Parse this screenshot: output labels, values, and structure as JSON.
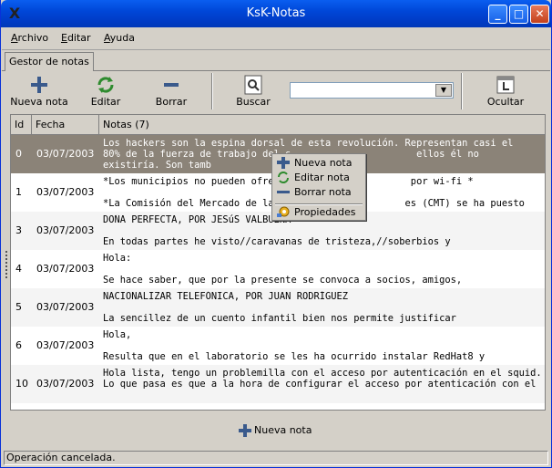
{
  "window": {
    "title": "KsK-Notas"
  },
  "menu": {
    "archivo": "Archivo",
    "editar": "Editar",
    "ayuda": "Ayuda"
  },
  "tab": {
    "label": "Gestor de notas"
  },
  "toolbar": {
    "new_note": "Nueva nota",
    "edit": "Editar",
    "delete": "Borrar",
    "search": "Buscar",
    "hide": "Ocultar",
    "search_value": ""
  },
  "table": {
    "columns": {
      "id": "Id",
      "date": "Fecha",
      "notes": "Notas (7)"
    },
    "rows": [
      {
        "id": "0",
        "date": "03/07/2003",
        "note": "Los hackers son la espina dorsal de esta revolución. Representan casi el\n80% de la fuerza de trabajo del s                      ellos él no\nexistiría. Son tamb"
      },
      {
        "id": "1",
        "date": "03/07/2003",
        "note": "*Los municipios no pueden ofrec                       por wi-fi *\n\n*La Comisión del Mercado de las                      es (CMT) se ha puesto"
      },
      {
        "id": "3",
        "date": "03/07/2003",
        "note": "DOÑA PERFECTA, POR JESúS VALBUENA\n\nEn todas partes he visto//caravanas de tristeza,//soberbios y"
      },
      {
        "id": "4",
        "date": "03/07/2003",
        "note": "Hola:\n\nSe hace saber, que por la presente se convoca a socios, amigos,"
      },
      {
        "id": "5",
        "date": "03/07/2003",
        "note": "NACIONALIZAR TELEFÓNICA, POR JUAN RODRÍGUEZ\n\nLa sencillez de un cuento infantil bien nos permite justificar"
      },
      {
        "id": "6",
        "date": "03/07/2003",
        "note": "Hola,\n\nResulta que en el laboratorio se les ha ocurrido instalar RedHat8 y"
      },
      {
        "id": "10",
        "date": "03/07/2003",
        "note": "Hola lista, tengo un problemilla con el acceso por autenticación en el squid.\nLo que pasa es que a la hora de configurar el acceso por atenticación con el nc"
      }
    ],
    "selected_index": 0
  },
  "context_menu": {
    "new_note": "Nueva nota",
    "edit_note": "Editar nota",
    "delete_note": "Borrar nota",
    "properties": "Propiedades"
  },
  "bottom": {
    "new_note": "Nueva nota"
  },
  "status": {
    "text": "Operación cancelada."
  },
  "colors": {
    "titlebar": "#0047d8",
    "selection": "#8b8378",
    "chrome": "#d4d0c8"
  }
}
